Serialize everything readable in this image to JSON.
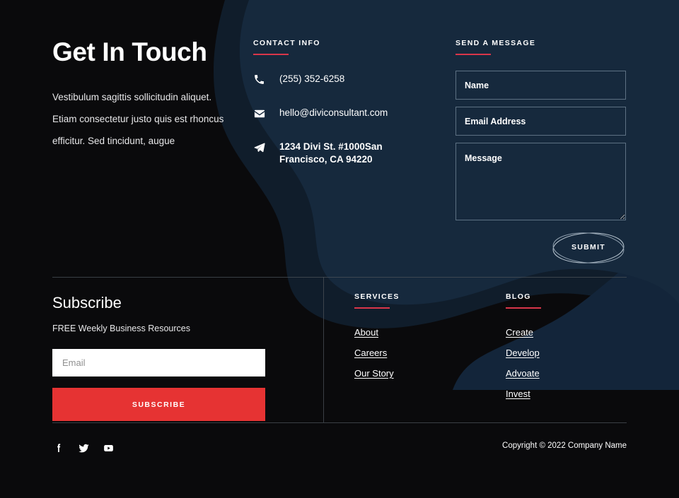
{
  "theme": {
    "background": "#0a0a0c",
    "blob_navy": "#16293d",
    "blob_shadow": "#101d2b",
    "accent_red": "#d9364a",
    "button_red": "#e63333",
    "text_white": "#ffffff",
    "divider": "#4b5258"
  },
  "hero": {
    "heading": "Get In Touch",
    "body": "Vestibulum sagittis sollicitudin aliquet. Etiam consectetur justo quis est rhoncus efficitur. Sed tincidunt, augue"
  },
  "contact": {
    "heading": "CONTACT INFO",
    "items": [
      {
        "icon": "phone-icon",
        "text": "(255) 352-6258",
        "bold": false
      },
      {
        "icon": "envelope-icon",
        "text": "hello@diviconsultant.com",
        "bold": false
      },
      {
        "icon": "paper-plane-icon",
        "text": "1234 Divi St. #1000San Francisco, CA 94220",
        "bold": true
      }
    ]
  },
  "message_form": {
    "heading": "SEND A MESSAGE",
    "fields": {
      "name_placeholder": "Name",
      "name_value": "",
      "email_placeholder": "Email Address",
      "email_value": "",
      "message_placeholder": "Message",
      "message_value": ""
    },
    "submit_label": "SUBMIT"
  },
  "subscribe": {
    "title": "Subscribe",
    "subtitle": "FREE Weekly Business Resources",
    "email_placeholder": "Email",
    "email_value": "",
    "button_label": "SUBSCRIBE"
  },
  "services": {
    "heading": "SERVICES",
    "links": [
      "About",
      "Careers",
      "Our Story"
    ]
  },
  "blog": {
    "heading": "BLOG",
    "links": [
      "Create",
      "Develop",
      "Advoate",
      "Invest"
    ]
  },
  "footer": {
    "social": [
      {
        "icon": "facebook-icon",
        "name": "Facebook"
      },
      {
        "icon": "twitter-icon",
        "name": "Twitter"
      },
      {
        "icon": "youtube-icon",
        "name": "YouTube"
      }
    ],
    "copyright": "Copyright © 2022 Company Name"
  }
}
